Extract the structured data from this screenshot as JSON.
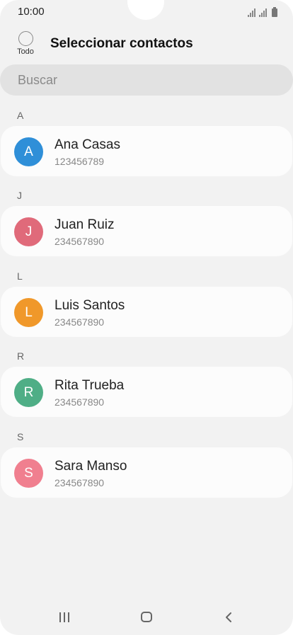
{
  "status_bar": {
    "time": "10:00"
  },
  "header": {
    "select_all_label": "Todo",
    "title": "Seleccionar contactos"
  },
  "search": {
    "placeholder": "Buscar"
  },
  "sections": [
    {
      "letter": "A",
      "contact": {
        "initial": "A",
        "name": "Ana Casas",
        "phone": "123456789",
        "color": "#2f8fd8"
      }
    },
    {
      "letter": "J",
      "contact": {
        "initial": "J",
        "name": "Juan Ruiz",
        "phone": "234567890",
        "color": "#e06a7a"
      }
    },
    {
      "letter": "L",
      "contact": {
        "initial": "L",
        "name": "Luis Santos",
        "phone": "234567890",
        "color": "#f0982a"
      }
    },
    {
      "letter": "R",
      "contact": {
        "initial": "R",
        "name": "Rita Trueba",
        "phone": "234567890",
        "color": "#4fae86"
      }
    },
    {
      "letter": "S",
      "contact": {
        "initial": "S",
        "name": "Sara Manso",
        "phone": "234567890",
        "color": "#f07f8f"
      }
    }
  ],
  "nav_bar": {
    "icons": [
      "recents-icon",
      "home-icon",
      "back-icon"
    ]
  }
}
